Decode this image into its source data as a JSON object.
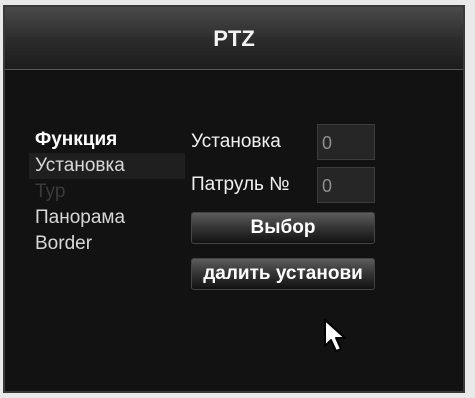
{
  "window": {
    "title": "PTZ"
  },
  "sidebar": {
    "items": [
      {
        "label": "Функция"
      },
      {
        "label": "Установка"
      },
      {
        "label": "Тур"
      },
      {
        "label": "Панорама"
      },
      {
        "label": "Border"
      }
    ]
  },
  "form": {
    "preset": {
      "label": "Установка",
      "value": "0"
    },
    "patrol": {
      "label": "Патруль №",
      "value": "0"
    }
  },
  "buttons": {
    "select_label": "Выбор",
    "delete_preset_label": "далить установи"
  },
  "icons": {
    "cursor": "mouse-pointer-icon"
  }
}
